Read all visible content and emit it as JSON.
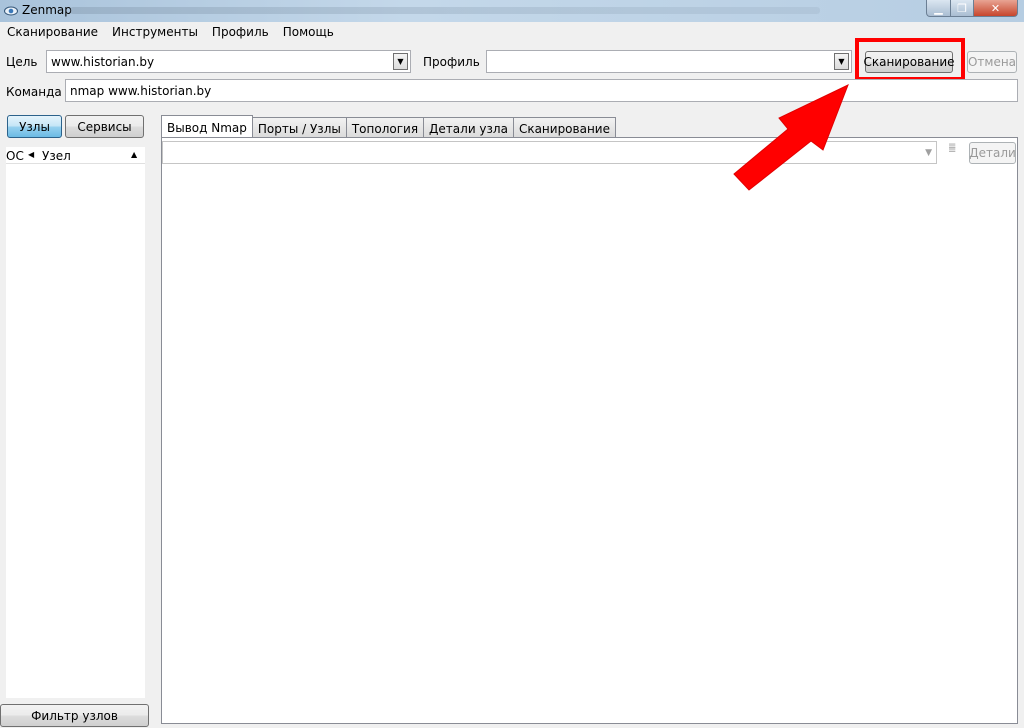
{
  "window": {
    "title": "Zenmap"
  },
  "menu": [
    "Сканирование",
    "Инструменты",
    "Профиль",
    "Помощь"
  ],
  "target": {
    "label": "Цель",
    "value": "www.historian.by"
  },
  "profile": {
    "label": "Профиль",
    "value": ""
  },
  "buttons": {
    "scan": "Сканирование",
    "cancel": "Отмена",
    "details": "Детали",
    "host_filter": "Фильтр узлов"
  },
  "command": {
    "label": "Команда",
    "value": "nmap www.historian.by"
  },
  "sidebar": {
    "toggle_hosts": "Узлы",
    "toggle_services": "Сервисы",
    "columns": {
      "os": "ОС",
      "host": "Узел"
    }
  },
  "tabs": [
    "Вывод Nmap",
    "Порты / Узлы",
    "Топология",
    "Детали узла",
    "Сканирование"
  ],
  "colors": {
    "annotation": "#ff0000"
  },
  "icons": [
    "zenmap-eye-icon",
    "minimize-icon",
    "maximize-icon",
    "close-icon",
    "chevron-down-icon",
    "sort-asc-icon",
    "grip-icon"
  ]
}
